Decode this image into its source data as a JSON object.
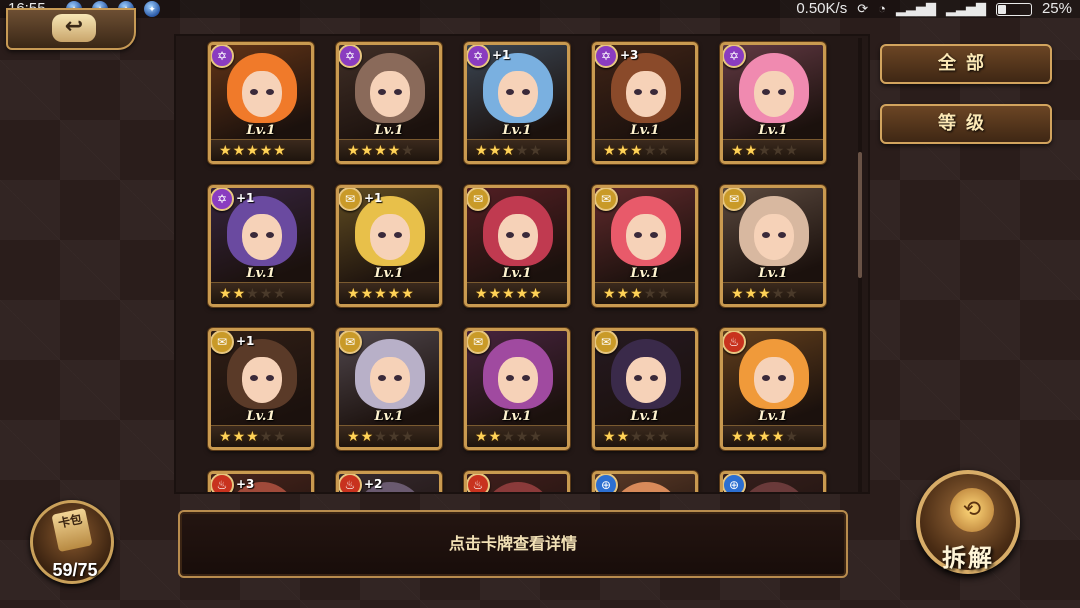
{
  "status_bar": {
    "time": "16:55",
    "network_speed": "0.50K/s",
    "battery": "25%",
    "battery_level": 0.25
  },
  "filters": {
    "all_label": "全部",
    "level_label": "等级"
  },
  "hint_text": "点击卡牌查看详情",
  "card_pack": {
    "label": "卡包",
    "count": "59/75"
  },
  "decompose_label": "拆解",
  "icons": {
    "back": "back-arrow-icon",
    "card_pack": "card-pack-icon",
    "decompose": "decompose-icon",
    "wifi": "wifi-icon",
    "signal": "signal-icon",
    "sync": "sync-icon"
  },
  "type_colors": {
    "hex": "#8a3cc0",
    "scroll": "#c99a28",
    "fire": "#c8321e",
    "cross": "#2c6fd1"
  },
  "cards": [
    {
      "level": "Lv.1",
      "stars": 5,
      "type": "hex",
      "rank": "",
      "hair": "#f07a2a"
    },
    {
      "level": "Lv.1",
      "stars": 4,
      "type": "hex",
      "rank": "",
      "hair": "#8a6a5a"
    },
    {
      "level": "Lv.1",
      "stars": 3,
      "type": "hex",
      "rank": "+1",
      "hair": "#7ab0e0"
    },
    {
      "level": "Lv.1",
      "stars": 3,
      "type": "hex",
      "rank": "+3",
      "hair": "#8a4a2a"
    },
    {
      "level": "Lv.1",
      "stars": 2,
      "type": "hex",
      "rank": "",
      "hair": "#f08ab0"
    },
    {
      "level": "Lv.1",
      "stars": 2,
      "type": "hex",
      "rank": "+1",
      "hair": "#6a4aa0"
    },
    {
      "level": "Lv.1",
      "stars": 5,
      "type": "scroll",
      "rank": "+1",
      "hair": "#e8c04a"
    },
    {
      "level": "Lv.1",
      "stars": 5,
      "type": "scroll",
      "rank": "",
      "hair": "#c03a50"
    },
    {
      "level": "Lv.1",
      "stars": 3,
      "type": "scroll",
      "rank": "",
      "hair": "#e85a6a"
    },
    {
      "level": "Lv.1",
      "stars": 3,
      "type": "scroll",
      "rank": "",
      "hair": "#d8b8a0"
    },
    {
      "level": "Lv.1",
      "stars": 3,
      "type": "scroll",
      "rank": "+1",
      "hair": "#5a3a28"
    },
    {
      "level": "Lv.1",
      "stars": 2,
      "type": "scroll",
      "rank": "",
      "hair": "#b8b0c8"
    },
    {
      "level": "Lv.1",
      "stars": 2,
      "type": "scroll",
      "rank": "",
      "hair": "#a04aa0"
    },
    {
      "level": "Lv.1",
      "stars": 2,
      "type": "scroll",
      "rank": "",
      "hair": "#3a2a4a"
    },
    {
      "level": "Lv.1",
      "stars": 4,
      "type": "fire",
      "rank": "",
      "hair": "#f09a3a"
    },
    {
      "level": "",
      "stars": 0,
      "type": "fire",
      "rank": "+3",
      "hair": "#a04a3a"
    },
    {
      "level": "",
      "stars": 0,
      "type": "fire",
      "rank": "+2",
      "hair": "#6a5a70"
    },
    {
      "level": "",
      "stars": 0,
      "type": "fire",
      "rank": "",
      "hair": "#8a3a3a"
    },
    {
      "level": "",
      "stars": 0,
      "type": "cross",
      "rank": "",
      "hair": "#d88a5a"
    },
    {
      "level": "",
      "stars": 0,
      "type": "cross",
      "rank": "",
      "hair": "#6a3a3a"
    }
  ]
}
